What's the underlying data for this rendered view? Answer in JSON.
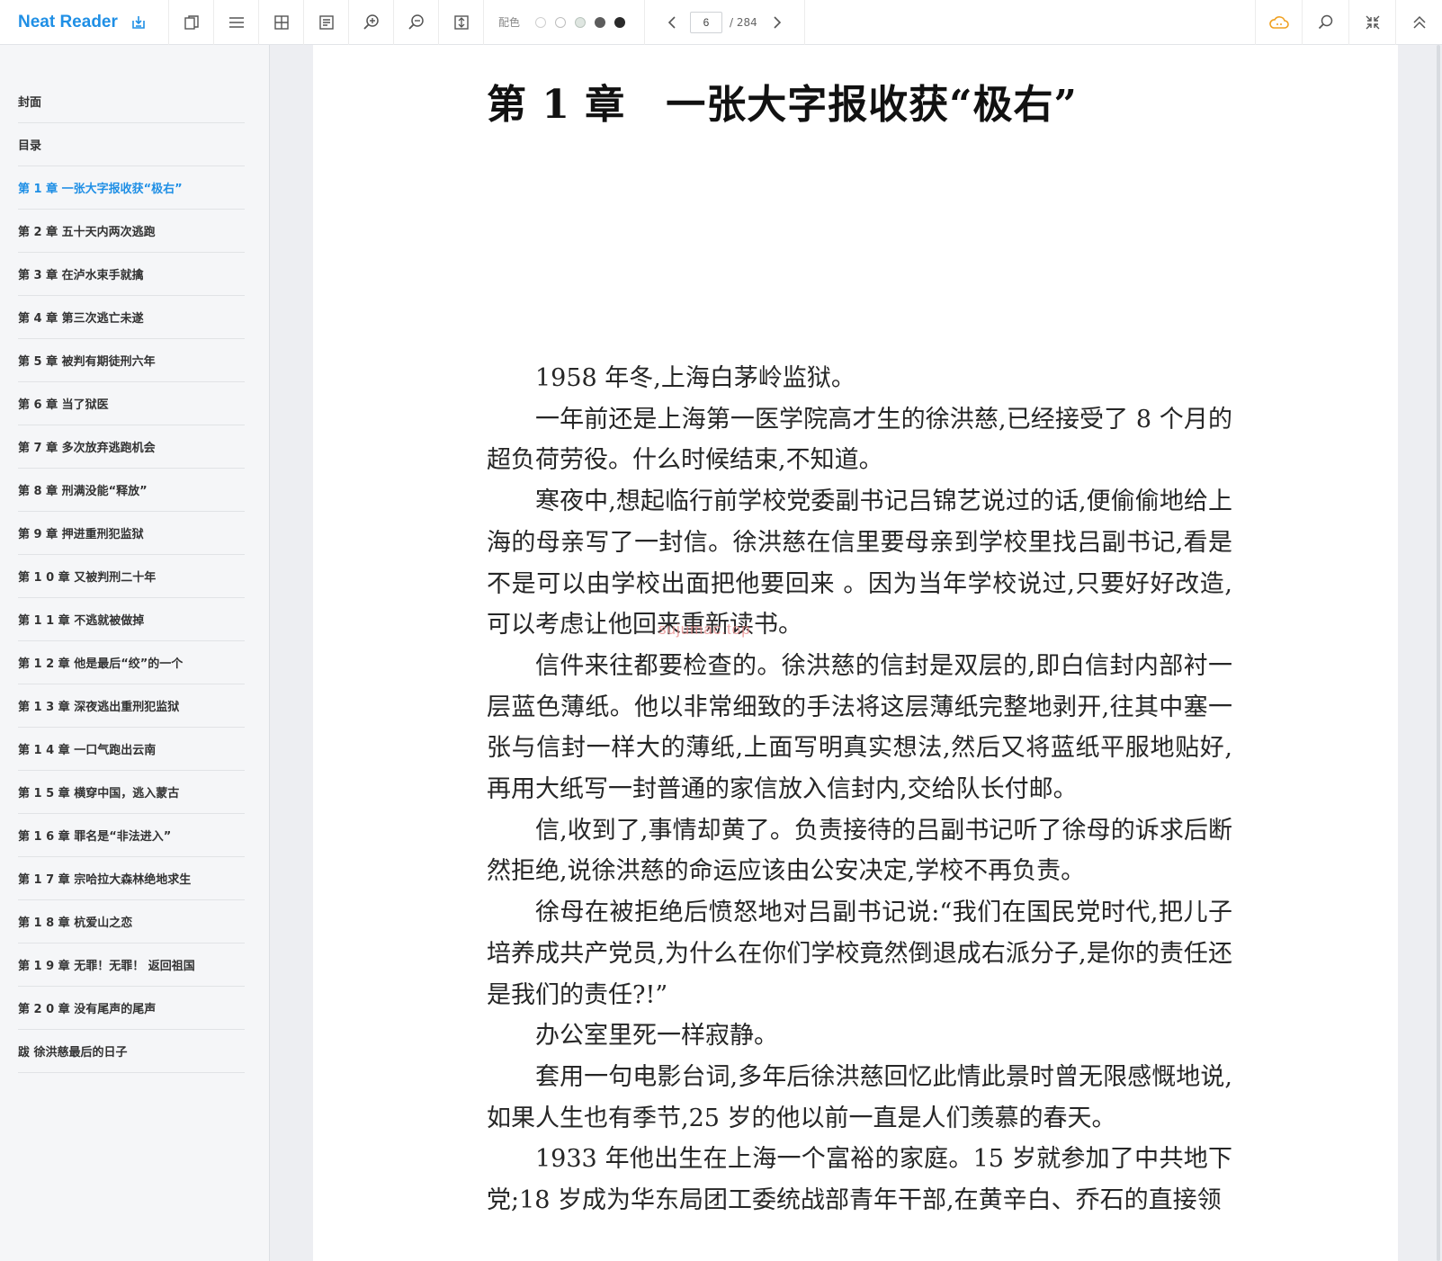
{
  "app": {
    "name": "Neat Reader"
  },
  "toolbar": {
    "palette_label": "配色",
    "palette_colors": [
      "#ffffff",
      "#ffffff",
      "#dfe6e1",
      "#5c5c5c",
      "#2a2a2a"
    ],
    "current_page": "6",
    "total_pages": "/ 284",
    "icons": [
      "import-icon",
      "copy-icon",
      "menu-icon",
      "grid-icon",
      "notes-icon",
      "zoom-in-icon",
      "zoom-out-icon",
      "fit-page-icon"
    ],
    "right_icons": [
      "cloud-icon",
      "search-icon",
      "collapse-icon",
      "chevron-up-icon"
    ]
  },
  "sidebar": {
    "items": [
      {
        "label": "封面",
        "active": false
      },
      {
        "label": "目录",
        "active": false
      },
      {
        "label": "第 1 章 一张大字报收获“极右”",
        "active": true
      },
      {
        "label": "第 2 章 五十天内两次逃跑",
        "active": false
      },
      {
        "label": "第 3 章 在泸水束手就擒",
        "active": false
      },
      {
        "label": "第 4 章 第三次逃亡未遂",
        "active": false
      },
      {
        "label": "第 5 章 被判有期徒刑六年",
        "active": false
      },
      {
        "label": "第 6 章 当了狱医",
        "active": false
      },
      {
        "label": "第 7 章 多次放弃逃跑机会",
        "active": false
      },
      {
        "label": "第 8 章 刑满没能“释放”",
        "active": false
      },
      {
        "label": "第 9 章 押进重刑犯监狱",
        "active": false
      },
      {
        "label": "第 1 0 章 又被判刑二十年",
        "active": false
      },
      {
        "label": "第 1 1 章 不逃就被做掉",
        "active": false
      },
      {
        "label": "第 1 2 章 他是最后“绞”的一个",
        "active": false
      },
      {
        "label": "第 1 3 章 深夜逃出重刑犯监狱",
        "active": false
      },
      {
        "label": "第 1 4 章 一口气跑出云南",
        "active": false
      },
      {
        "label": "第 1 5 章 横穿中国，逃入蒙古",
        "active": false
      },
      {
        "label": "第 1 6 章 罪名是“非法进入”",
        "active": false
      },
      {
        "label": "第 1 7 章 宗哈拉大森林绝地求生",
        "active": false
      },
      {
        "label": "第 1 8 章 杭爱山之恋",
        "active": false
      },
      {
        "label": "第 1 9 章 无罪！无罪！ 返回祖国",
        "active": false
      },
      {
        "label": "第 2 0 章 没有尾声的尾声",
        "active": false
      },
      {
        "label": "跋 徐洪慈最后的日子",
        "active": false
      }
    ]
  },
  "content": {
    "chapter_title": "第 1 章　一张大字报收获“极右”",
    "paragraphs": [
      "1958 年冬,上海白茅岭监狱。",
      "一年前还是上海第一医学院高才生的徐洪慈,已经接受了 8 个月的超负荷劳役。什么时候结束,不知道。",
      "寒夜中,想起临行前学校党委副书记吕锦艺说过的话,便偷偷地给上海的母亲写了一封信。徐洪慈在信里要母亲到学校里找吕副书记,看是不是可以由学校出面把他要回来 。因为当年学校说过,只要好好改造,可以考虑让他回来重新读书。",
      "信件来往都要检查的。徐洪慈的信封是双层的,即白信封内部衬一层蓝色薄纸。他以非常细致的手法将这层薄纸完整地剥开,往其中塞一张与信封一样大的薄纸,上面写明真实想法,然后又将蓝纸平服地贴好,再用大纸写一封普通的家信放入信封内,交给队长付邮。",
      "信,收到了,事情却黄了。负责接待的吕副书记听了徐母的诉求后断然拒绝,说徐洪慈的命运应该由公安决定,学校不再负责。",
      "徐母在被拒绝后愤怒地对吕副书记说:“我们在国民党时代,把儿子培养成共产党员,为什么在你们学校竟然倒退成右派分子,是你的责任还是我们的责任?!”",
      "办公室里死一样寂静。",
      "套用一句电影台词,多年后徐洪慈回忆此情此景时曾无限感慨地说,如果人生也有季节,25 岁的他以前一直是人们羡慕的春天。",
      "1933 年他出生在上海一个富裕的家庭。15 岁就参加了中共地下党;18 岁成为华东局团工委统战部青年干部,在黄辛白、乔石的直接领"
    ],
    "watermark": "sujumac.top"
  },
  "colors": {
    "accent": "#1f8fe5",
    "cloud": "#f0a020"
  }
}
